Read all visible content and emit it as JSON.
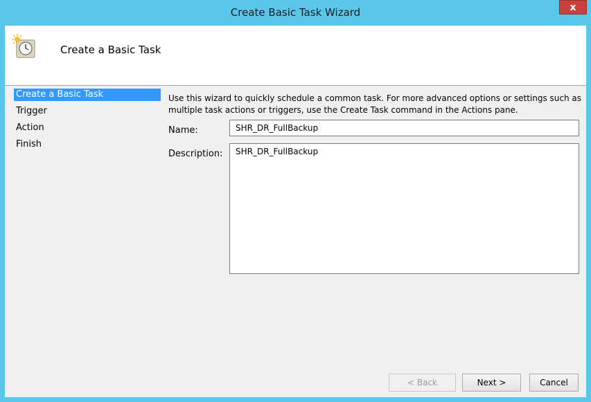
{
  "window": {
    "title": "Create Basic Task Wizard",
    "close_glyph": "x"
  },
  "header": {
    "title": "Create a Basic Task",
    "icon": "clock-icon"
  },
  "nav": {
    "items": [
      {
        "label": "Create a Basic Task",
        "selected": true
      },
      {
        "label": "Trigger"
      },
      {
        "label": "Action"
      },
      {
        "label": "Finish"
      }
    ]
  },
  "intro": "Use this wizard to quickly schedule a common task.  For more advanced options or settings such as multiple task actions or triggers, use the Create Task command in the Actions pane.",
  "form": {
    "name_label": "Name:",
    "name_value": "SHR_DR_FullBackup",
    "description_label": "Description:",
    "description_value": "SHR_DR_FullBackup"
  },
  "buttons": {
    "back": "< Back",
    "next": "Next >",
    "cancel": "Cancel"
  },
  "colors": {
    "titlebar": "#5ac6ea",
    "selection": "#3399ff",
    "close": "#c8423b"
  }
}
